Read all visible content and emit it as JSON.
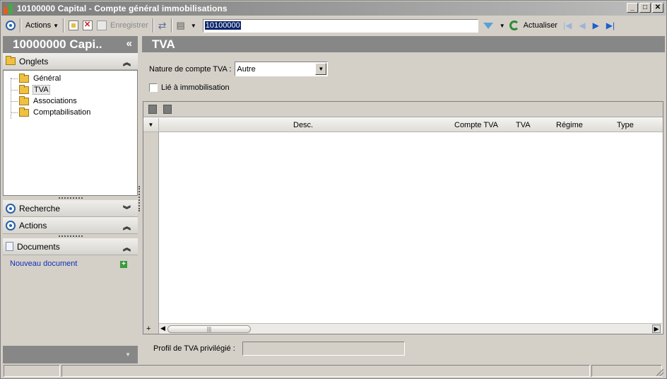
{
  "window": {
    "title": "10100000 Capital - Compte général immobilisations"
  },
  "toolbar": {
    "actions_label": "Actions",
    "save_label": "Enregistrer",
    "search_value": "10100000",
    "refresh_label": "Actualiser"
  },
  "sidebar": {
    "header": "10000000 Capi..",
    "collapse_glyph": "«",
    "onglets_label": "Onglets",
    "tree": [
      {
        "label": "Général"
      },
      {
        "label": "TVA"
      },
      {
        "label": "Associations"
      },
      {
        "label": "Comptabilisation"
      }
    ],
    "recherche_label": "Recherche",
    "actions_label": "Actions",
    "documents_label": "Documents",
    "new_document_label": "Nouveau document"
  },
  "main": {
    "title": "TVA",
    "nature_label": "Nature de compte TVA :",
    "nature_value": "Autre",
    "immob_label": "Lié à immobilisation",
    "grid_columns": [
      "Desc.",
      "Compte TVA",
      "TVA",
      "Régime",
      "Type"
    ],
    "profile_label": "Profil de TVA privilégié :"
  },
  "colors": {
    "panel_header": "#878787",
    "accent_blue": "#2a5fa8",
    "link": "#1030b8"
  }
}
